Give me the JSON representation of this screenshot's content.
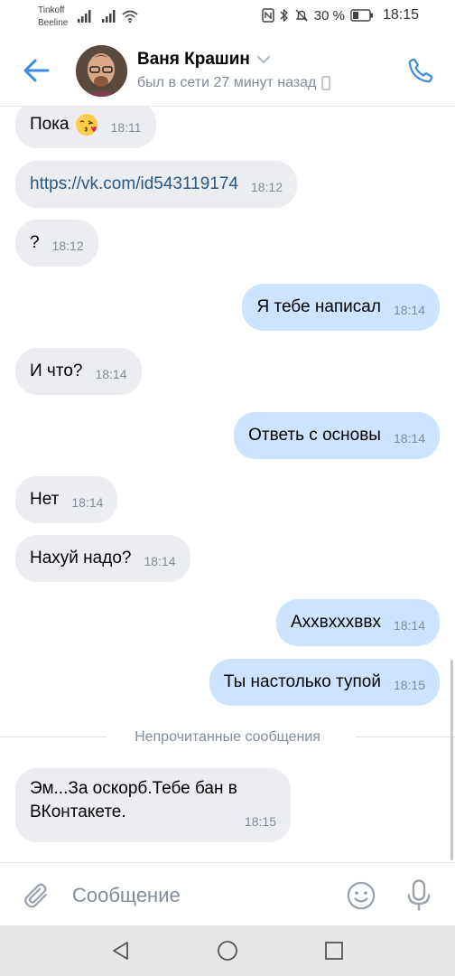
{
  "status_bar": {
    "carrier1": "Tinkoff",
    "carrier2": "Beeline",
    "battery": "30 %",
    "time": "18:15"
  },
  "header": {
    "contact_name": "Ваня Крашин",
    "last_seen": "был в сети 27 минут назад"
  },
  "messages": [
    {
      "direction": "in",
      "text": "Пока",
      "emoji": "kissing-face-emoji",
      "time": "18:11"
    },
    {
      "direction": "in",
      "text": "https://vk.com/id543119174",
      "is_link": true,
      "time": "18:12"
    },
    {
      "direction": "in",
      "text": "?",
      "time": "18:12"
    },
    {
      "direction": "out",
      "text": "Я тебе написал",
      "time": "18:14"
    },
    {
      "direction": "in",
      "text": "И что?",
      "time": "18:14"
    },
    {
      "direction": "out",
      "text": "Ответь с основы",
      "time": "18:14"
    },
    {
      "direction": "in",
      "text": "Нет",
      "time": "18:14"
    },
    {
      "direction": "in",
      "text": "Нахуй надо?",
      "time": "18:14"
    },
    {
      "direction": "out",
      "text": "Аххвхххввх",
      "time": "18:14"
    },
    {
      "direction": "out",
      "text": "Ты настолько тупой",
      "time": "18:15"
    },
    {
      "direction": "in",
      "text": "Эм...За оскорб.Тебе бан в ВКонтакете.",
      "time": "18:15"
    }
  ],
  "unread_divider": "Непрочитанные сообщения",
  "composer": {
    "placeholder": "Сообщение"
  },
  "colors": {
    "accent": "#3f8ae0",
    "incoming_bubble": "#ebedf0",
    "outgoing_bubble": "#cce4ff",
    "secondary_text": "#818c99",
    "link": "#2a5885"
  },
  "icons": [
    "back-arrow-icon",
    "phone-icon",
    "chevron-down-icon",
    "mobile-device-icon",
    "paperclip-icon",
    "smile-icon",
    "microphone-icon",
    "nav-back-icon",
    "nav-home-icon",
    "nav-recents-icon"
  ]
}
